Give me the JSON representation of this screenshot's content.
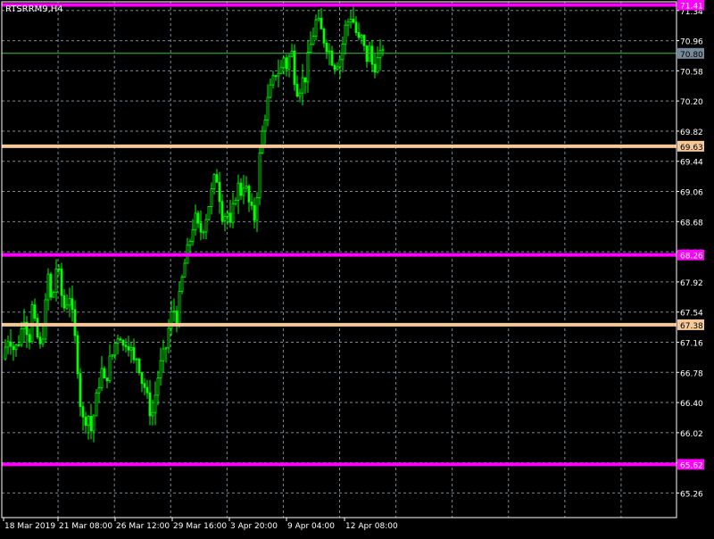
{
  "chart_data": {
    "type": "candlestick",
    "symbol_title": "RTSRRM9,H4",
    "ylim": [
      64.95,
      71.45
    ],
    "y_ticks": [
      "71.34",
      "70.96",
      "70.58",
      "70.20",
      "69.82",
      "69.44",
      "69.06",
      "68.68",
      "68.30",
      "67.92",
      "67.54",
      "67.16",
      "66.78",
      "66.40",
      "66.02",
      "65.64",
      "65.26"
    ],
    "y_tick_values": [
      71.34,
      70.96,
      70.58,
      70.2,
      69.82,
      69.44,
      69.06,
      68.68,
      68.3,
      67.92,
      67.54,
      67.16,
      66.78,
      66.4,
      66.02,
      65.64,
      65.26
    ],
    "x_labels": [
      "18 Mar 2019",
      "21 Mar 08:00",
      "26 Mar 12:00",
      "29 Mar 16:00",
      "3 Apr 20:00",
      "9 Apr 04:00",
      "12 Apr 08:00"
    ],
    "levels": [
      {
        "label": "71.41",
        "value": 71.41,
        "color": "#ff00ff"
      },
      {
        "label": "70.80",
        "value": 70.8,
        "color": "#32c832"
      },
      {
        "label": "69.63",
        "value": 69.63,
        "color": "#f5c89a"
      },
      {
        "label": "68.26",
        "value": 68.26,
        "color": "#ff00ff"
      },
      {
        "label": "67.38",
        "value": 67.38,
        "color": "#f5c89a"
      },
      {
        "label": "65.62",
        "value": 65.62,
        "color": "#ff00ff"
      }
    ],
    "colors": {
      "background": "#000000",
      "grid": "#778899",
      "candle": "#00ff00",
      "axis_text": "#ffffff"
    },
    "close_path": [
      [
        0,
        66.95
      ],
      [
        8,
        67.25
      ],
      [
        14,
        67.05
      ],
      [
        20,
        67.2
      ],
      [
        26,
        67.55
      ],
      [
        30,
        67.1
      ],
      [
        34,
        67.6
      ],
      [
        38,
        67.3
      ],
      [
        44,
        67.05
      ],
      [
        48,
        67.5
      ],
      [
        52,
        68.0
      ],
      [
        56,
        67.6
      ],
      [
        62,
        68.2
      ],
      [
        66,
        67.8
      ],
      [
        70,
        67.6
      ],
      [
        76,
        67.75
      ],
      [
        80,
        67.4
      ],
      [
        84,
        67.0
      ],
      [
        88,
        66.4
      ],
      [
        92,
        66.1
      ],
      [
        96,
        66.3
      ],
      [
        100,
        66.05
      ],
      [
        104,
        66.3
      ],
      [
        108,
        66.6
      ],
      [
        112,
        66.8
      ],
      [
        116,
        66.6
      ],
      [
        120,
        66.9
      ],
      [
        124,
        67.0
      ],
      [
        128,
        67.2
      ],
      [
        132,
        67.3
      ],
      [
        136,
        67.1
      ],
      [
        140,
        67.2
      ],
      [
        144,
        67.1
      ],
      [
        148,
        66.9
      ],
      [
        152,
        67.0
      ],
      [
        156,
        66.7
      ],
      [
        160,
        66.6
      ],
      [
        164,
        66.4
      ],
      [
        168,
        66.2
      ],
      [
        172,
        66.5
      ],
      [
        176,
        66.8
      ],
      [
        180,
        66.95
      ],
      [
        184,
        67.1
      ],
      [
        188,
        67.4
      ],
      [
        192,
        67.6
      ],
      [
        196,
        67.45
      ],
      [
        200,
        67.8
      ],
      [
        204,
        68.1
      ],
      [
        208,
        68.3
      ],
      [
        212,
        68.5
      ],
      [
        216,
        68.75
      ],
      [
        220,
        68.6
      ],
      [
        224,
        68.55
      ],
      [
        228,
        68.7
      ],
      [
        232,
        68.9
      ],
      [
        236,
        69.1
      ],
      [
        240,
        69.3
      ],
      [
        244,
        69.0
      ],
      [
        248,
        68.7
      ],
      [
        252,
        68.85
      ],
      [
        256,
        68.6
      ],
      [
        260,
        68.9
      ],
      [
        264,
        69.15
      ],
      [
        268,
        69.05
      ],
      [
        272,
        69.2
      ],
      [
        276,
        68.95
      ],
      [
        280,
        68.8
      ],
      [
        284,
        68.7
      ],
      [
        288,
        69.4
      ],
      [
        292,
        69.8
      ],
      [
        296,
        70.1
      ],
      [
        300,
        70.3
      ],
      [
        304,
        70.45
      ],
      [
        308,
        70.6
      ],
      [
        312,
        70.55
      ],
      [
        316,
        70.75
      ],
      [
        320,
        70.6
      ],
      [
        324,
        70.9
      ],
      [
        328,
        70.5
      ],
      [
        332,
        70.3
      ],
      [
        336,
        70.45
      ],
      [
        340,
        70.5
      ],
      [
        344,
        70.8
      ],
      [
        348,
        71.0
      ],
      [
        352,
        71.2
      ],
      [
        356,
        71.15
      ],
      [
        360,
        71.0
      ],
      [
        364,
        70.9
      ],
      [
        368,
        70.8
      ],
      [
        372,
        70.65
      ],
      [
        376,
        70.7
      ],
      [
        380,
        70.75
      ],
      [
        384,
        71.1
      ],
      [
        388,
        71.2
      ],
      [
        392,
        71.3
      ],
      [
        396,
        71.1
      ],
      [
        400,
        70.95
      ],
      [
        404,
        71.0
      ],
      [
        408,
        70.7
      ],
      [
        412,
        70.85
      ],
      [
        416,
        70.6
      ],
      [
        420,
        70.7
      ],
      [
        424,
        70.75
      ],
      [
        428,
        70.95
      ]
    ]
  }
}
